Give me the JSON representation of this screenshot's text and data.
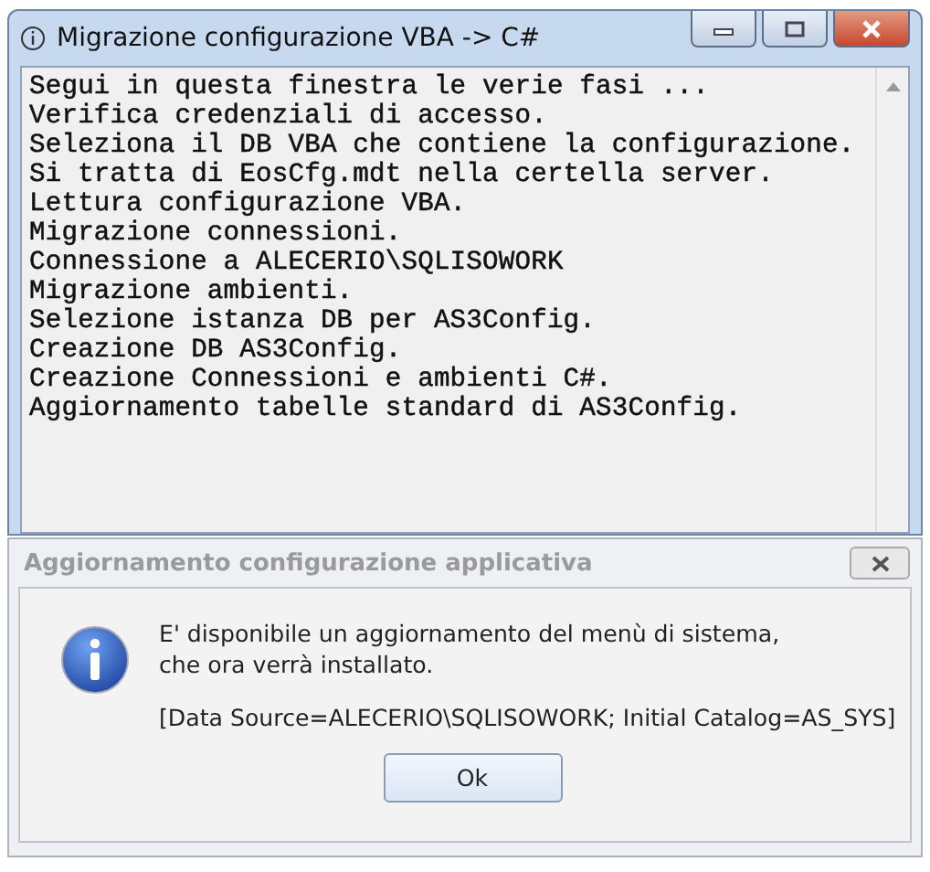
{
  "window": {
    "title": "Migrazione configurazione VBA -> C#"
  },
  "log_lines": [
    "Segui in questa finestra le verie fasi ...",
    "Verifica credenziali di accesso.",
    "Seleziona il DB VBA che contiene la configurazione.",
    "Si tratta di EosCfg.mdt nella certella server.",
    "Lettura configurazione VBA.",
    "Migrazione connessioni.",
    "Connessione a ALECERIO\\SQLISOWORK",
    "Migrazione ambienti.",
    "Selezione istanza DB per AS3Config.",
    "Creazione DB AS3Config.",
    "Creazione Connessioni e ambienti C#.",
    "Aggiornamento tabelle standard di AS3Config."
  ],
  "dialog": {
    "title": "Aggiornamento configurazione applicativa",
    "message": "E' disponibile un aggiornamento del menù di sistema,\nche ora verrà installato.",
    "detail": "[Data Source=ALECERIO\\SQLISOWORK; Initial Catalog=AS_SYS]",
    "buttons": [
      "Ok"
    ]
  }
}
